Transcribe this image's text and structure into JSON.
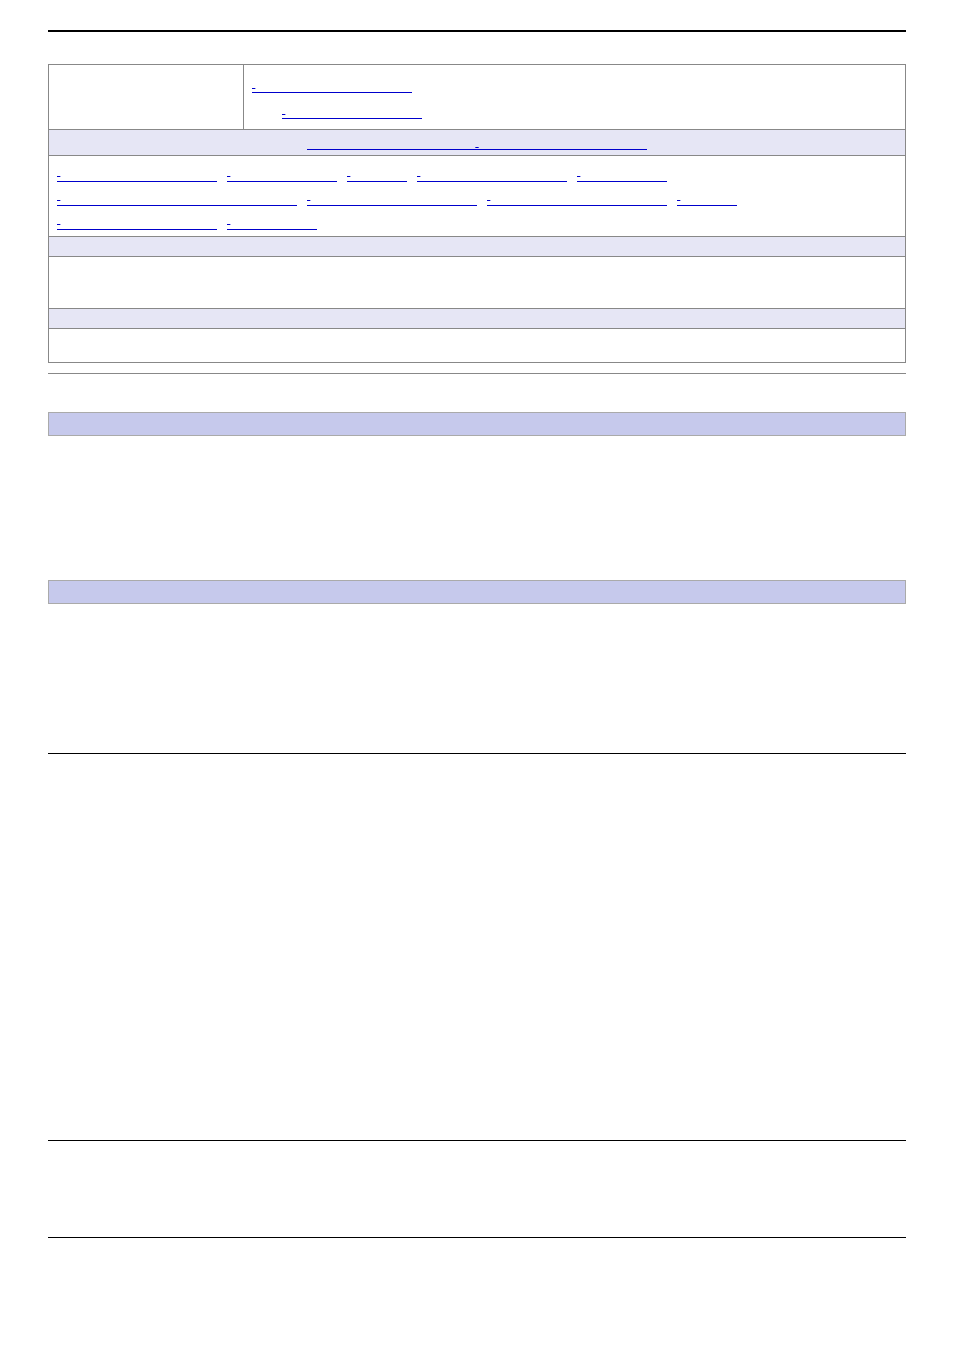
{
  "header": {
    "left_label": "",
    "right_link_1": "",
    "right_link_2": ""
  },
  "band1": {
    "center_link": ""
  },
  "links_row": {
    "items": [
      "",
      "",
      "",
      "",
      "",
      "",
      "",
      "",
      "",
      "",
      ""
    ]
  },
  "band2": {
    "text": ""
  },
  "white_block": {
    "text": ""
  },
  "band3": {
    "text": ""
  },
  "white_block2": {
    "text": ""
  }
}
